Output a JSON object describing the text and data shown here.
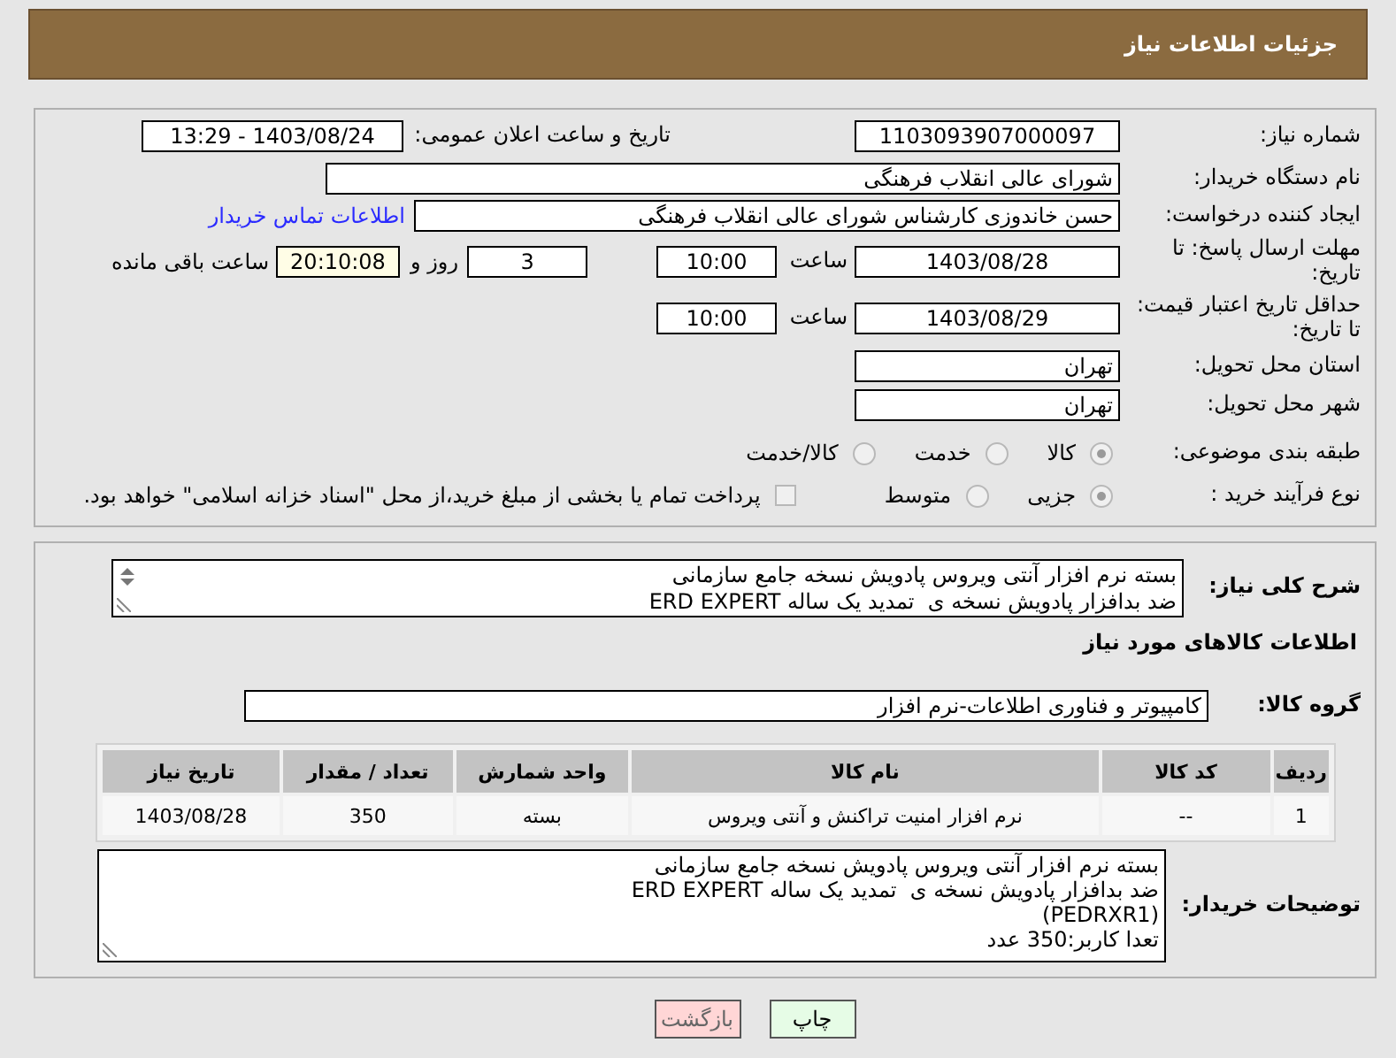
{
  "header": {
    "title": "جزئیات اطلاعات نیاز"
  },
  "need_number": {
    "label": "شماره نیاز:",
    "value": "1103093907000097"
  },
  "announce_date": {
    "label": "تاریخ و ساعت اعلان عمومی:",
    "value": "1403/08/24 - 13:29"
  },
  "buyer_org": {
    "label": "نام دستگاه خریدار:",
    "value": "شورای عالی انقلاب فرهنگی"
  },
  "requester": {
    "label": "ایجاد کننده درخواست:",
    "value": "حسن خاندوزی کارشناس شورای عالی انقلاب فرهنگی",
    "link": "اطلاعات تماس خریدار"
  },
  "reply_deadline": {
    "label": "مهلت ارسال پاسخ: تا تاریخ:",
    "date": "1403/08/28",
    "time_label": "ساعت",
    "time": "10:00",
    "days": "3",
    "days_label": "روز و",
    "remaining": "20:10:08",
    "remaining_label": "ساعت باقی مانده"
  },
  "price_validity": {
    "label": "حداقل تاریخ اعتبار قیمت: تا تاریخ:",
    "date": "1403/08/29",
    "time_label": "ساعت",
    "time": "10:00"
  },
  "province": {
    "label": "استان محل تحویل:",
    "value": "تهران"
  },
  "city": {
    "label": "شهر محل تحویل:",
    "value": "تهران"
  },
  "category": {
    "label": "طبقه بندی موضوعی:",
    "options": [
      {
        "label": "کالا",
        "selected": true
      },
      {
        "label": "خدمت",
        "selected": false
      },
      {
        "label": "کالا/خدمت",
        "selected": false
      }
    ]
  },
  "purchase_type": {
    "label": "نوع فرآیند خرید :",
    "options": [
      {
        "label": "جزیی",
        "selected": true
      },
      {
        "label": "متوسط",
        "selected": false
      }
    ],
    "payment_note": {
      "label": "پرداخت تمام یا بخشی از مبلغ خرید،از محل \"اسناد خزانه اسلامی\" خواهد بود.",
      "checked": false
    }
  },
  "description": {
    "label": "شرح کلی نیاز:",
    "value": "بسته نرم افزار آنتی ویروس پادویش نسخه جامع سازمانی\nضد بدافزار پادویش نسخه ی  تمدید یک ساله ERD EXPERT"
  },
  "items_heading": "اطلاعات کالاهای مورد نیاز",
  "goods_group": {
    "label": "گروه کالا:",
    "value": "کامپیوتر و فناوری اطلاعات-نرم افزار"
  },
  "table": {
    "columns": [
      "ردیف",
      "کد کالا",
      "نام کالا",
      "واحد شمارش",
      "تعداد / مقدار",
      "تاریخ نیاز"
    ],
    "rows": [
      [
        "1",
        "--",
        "نرم افزار امنیت تراکنش و آنتی ویروس",
        "بسته",
        "350",
        "1403/08/28"
      ]
    ]
  },
  "buyer_notes": {
    "label": "توضیحات خریدار:",
    "value": "بسته نرم افزار آنتی ویروس پادویش نسخه جامع سازمانی\nضد بدافزار پادویش نسخه ی  تمدید یک ساله ERD EXPERT\n(PEDRXR1)\nتعدا کاربر:350 عدد"
  },
  "buttons": [
    {
      "label": "چاپ",
      "kind": "print"
    },
    {
      "label": "بازگشت",
      "kind": "back"
    }
  ]
}
